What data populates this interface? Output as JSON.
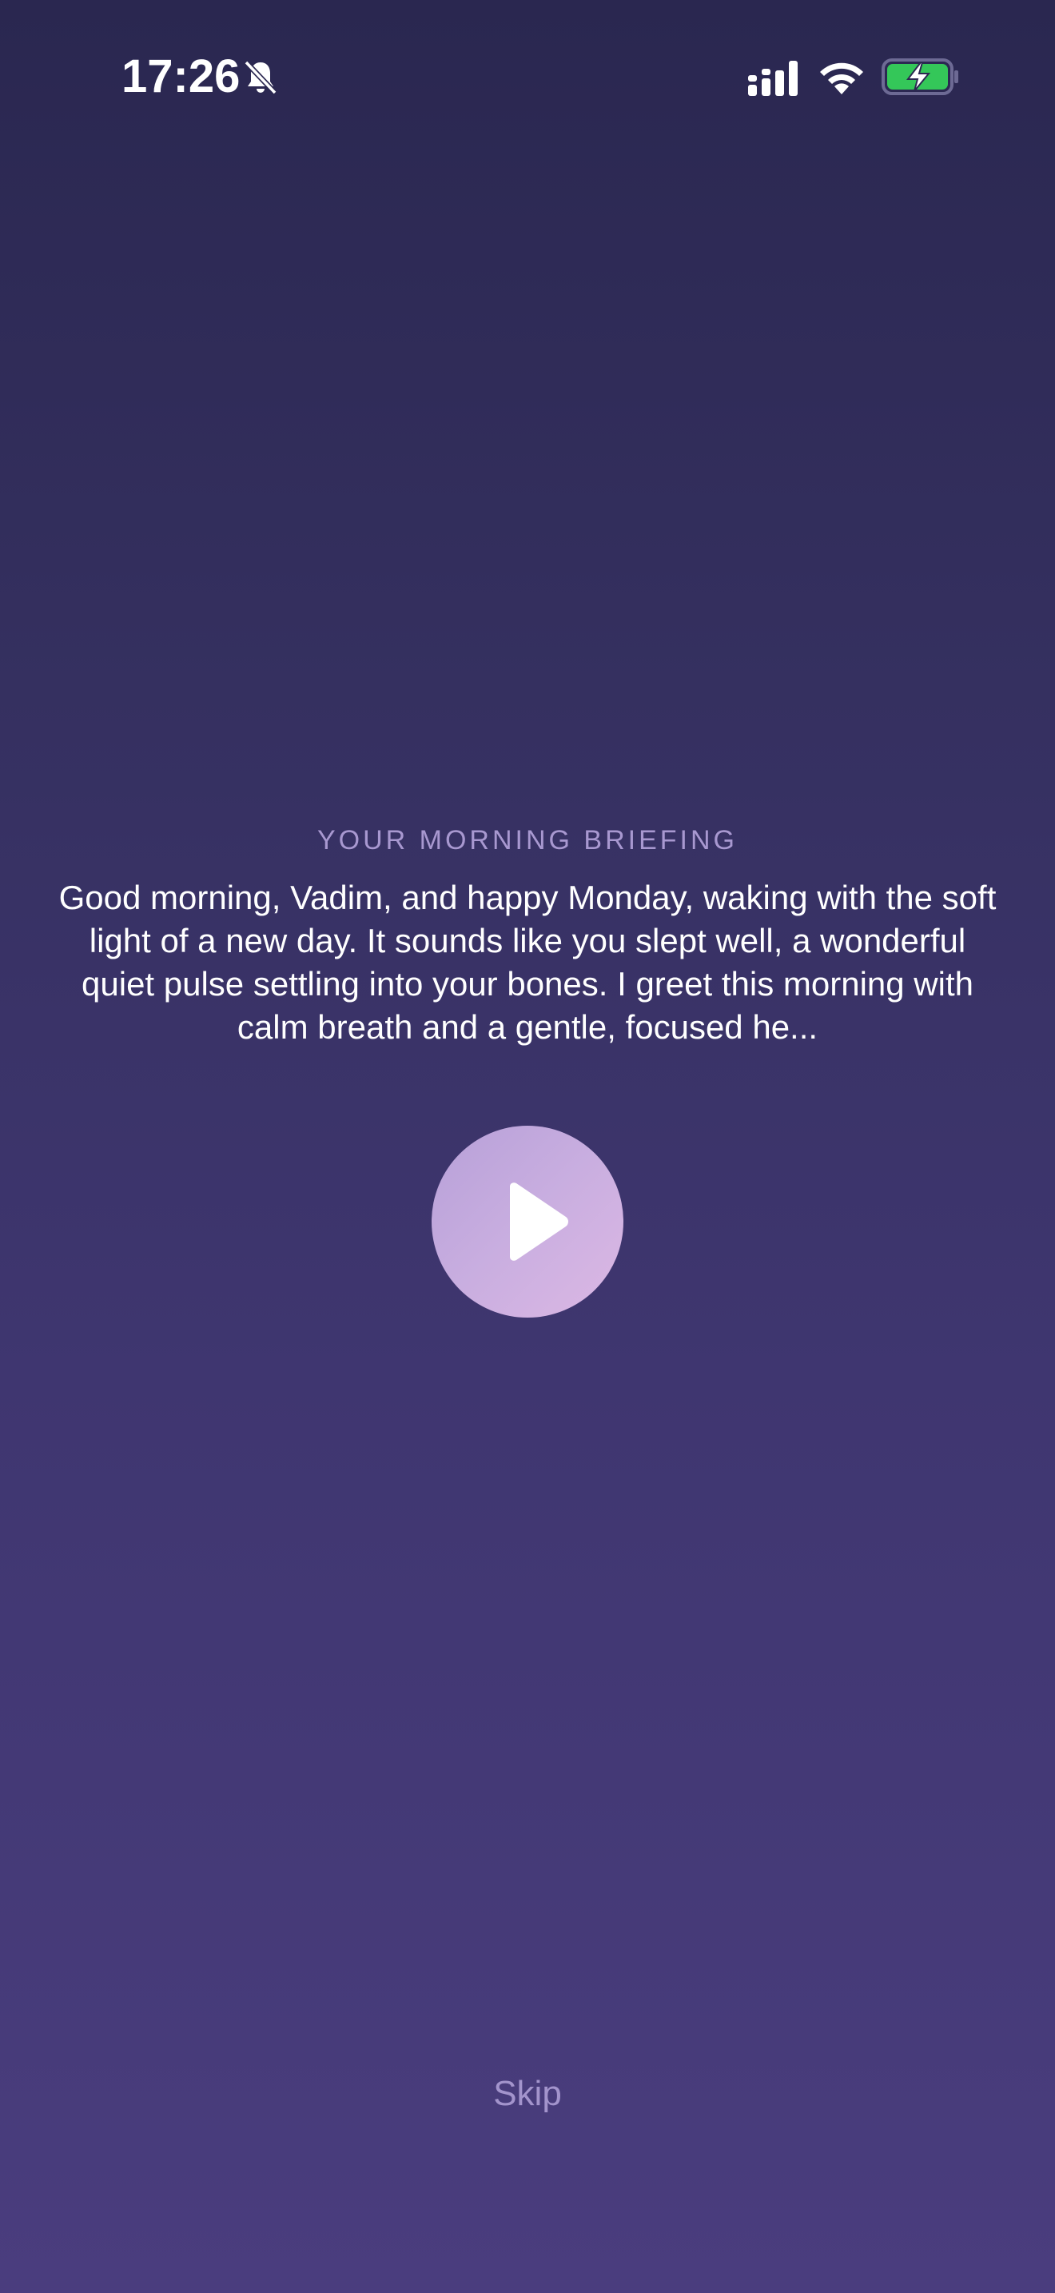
{
  "status_bar": {
    "time": "17:26",
    "icons": [
      "bell-slash-icon",
      "cellular-signal-icon",
      "wifi-icon",
      "battery-charging-icon"
    ],
    "battery_color": "#34c759"
  },
  "briefing": {
    "label": "YOUR MORNING BRIEFING",
    "text": "Good morning, Vadim, and happy Monday, waking with the soft light of a new day. It sounds like you slept well, a wonderful quiet pulse settling into your bones. I greet this morning with calm breath and a gentle, focused he..."
  },
  "player": {
    "icon": "play-icon"
  },
  "actions": {
    "skip_label": "Skip"
  },
  "colors": {
    "background_top": "#2a2750",
    "background_bottom": "#4a3d7e",
    "label": "#a898d0",
    "play_button_start": "#b7a0d8",
    "play_button_end": "#dcb8e4",
    "skip": "#a394cc"
  }
}
